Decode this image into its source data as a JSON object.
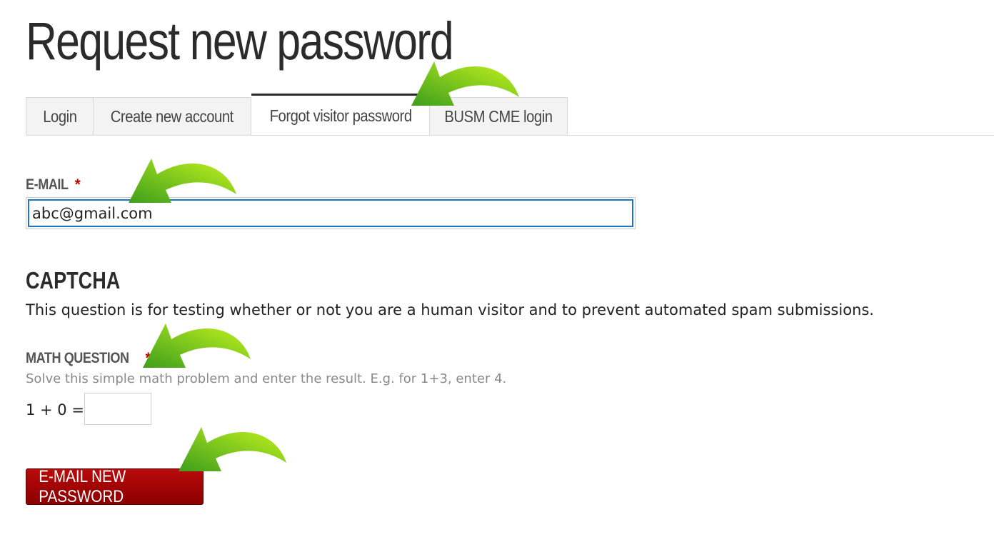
{
  "page": {
    "title": "Request new password"
  },
  "tabs": [
    {
      "label": "Login",
      "active": false
    },
    {
      "label": "Create new account",
      "active": false
    },
    {
      "label": "Forgot visitor password",
      "active": true
    },
    {
      "label": "BUSM CME login",
      "active": false
    }
  ],
  "email": {
    "label": "E-MAIL",
    "required_mark": "*",
    "value": "abc@gmail.com"
  },
  "captcha": {
    "title": "CAPTCHA",
    "description": "This question is for testing whether or not you are a human visitor and to prevent automated spam submissions.",
    "math_label": "MATH QUESTION",
    "required_mark": "*",
    "help": "Solve this simple math problem and enter the result. E.g. for 1+3, enter 4.",
    "equation": "1 + 0 =",
    "answer": ""
  },
  "submit": {
    "label": "E-MAIL NEW PASSWORD"
  },
  "colors": {
    "accent_button": "#a00000",
    "focus_border": "#1a76c9",
    "required": "#c30000",
    "annotation_arrow": "#7ac416"
  }
}
